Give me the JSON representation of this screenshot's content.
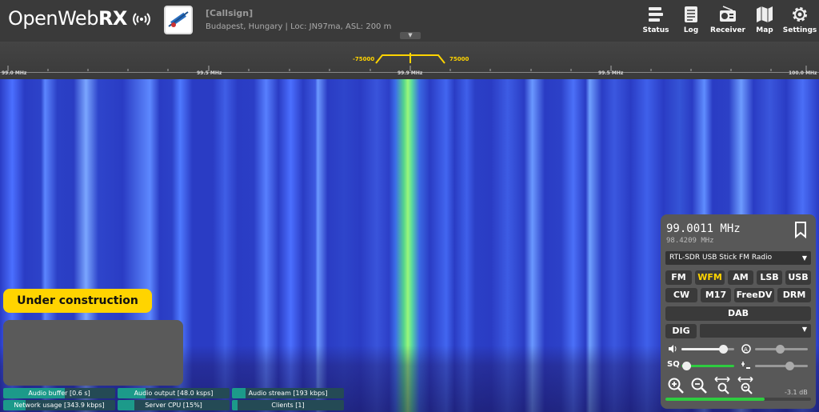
{
  "header": {
    "logo_light": "OpenWeb",
    "logo_bold": "RX",
    "callsign": "[Callsign]",
    "location": "Budapest, Hungary | Loc: JN97ma, ASL: 200 m",
    "nav": [
      {
        "label": "Status",
        "icon": "status-icon"
      },
      {
        "label": "Log",
        "icon": "log-icon"
      },
      {
        "label": "Receiver",
        "icon": "receiver-icon"
      },
      {
        "label": "Map",
        "icon": "map-icon"
      },
      {
        "label": "Settings",
        "icon": "settings-icon"
      }
    ]
  },
  "scale": {
    "labels": [
      "99.0 MHz",
      "99.5 MHz",
      "99.9 MHz",
      "99.5 MHz",
      "100.0 MHz"
    ],
    "bw_left": "-75000",
    "bw_right": "75000"
  },
  "under_construction": "Under construction",
  "status": {
    "audio_buffer": {
      "label": "Audio buffer [0.6 s]",
      "fraction": 0.55
    },
    "audio_output": {
      "label": "Audio output [48.0 ksps]",
      "fraction": 0.25
    },
    "audio_stream": {
      "label": "Audio stream [193 kbps]",
      "fraction": 0.12
    },
    "network_usage": {
      "label": "Network usage [343.9 kbps]",
      "fraction": 0.2
    },
    "server_cpu": {
      "label": "Server CPU [15%]",
      "fraction": 0.15
    },
    "clients": {
      "label": "Clients [1]",
      "fraction": 0.05
    }
  },
  "receiver": {
    "frequency": "99.0011 MHz",
    "sub_frequency": "98.4209 MHz",
    "profile": "RTL-SDR USB Stick FM Radio",
    "modes_row1": [
      "FM",
      "WFM",
      "AM",
      "LSB",
      "USB"
    ],
    "modes_row2": [
      "CW",
      "M17",
      "FreeDV",
      "DRM"
    ],
    "mode_dab": "DAB",
    "mode_dig": "DIG",
    "active_mode": "WFM",
    "volume": 0.85,
    "squelch": 0.02,
    "level_db": "-3.1 dB",
    "level_fraction": 0.68,
    "sq_label": "SQ"
  },
  "colors": {
    "accent": "#ffd400",
    "header_bg": "#3a3a3a",
    "panel_bg": "#585858"
  }
}
